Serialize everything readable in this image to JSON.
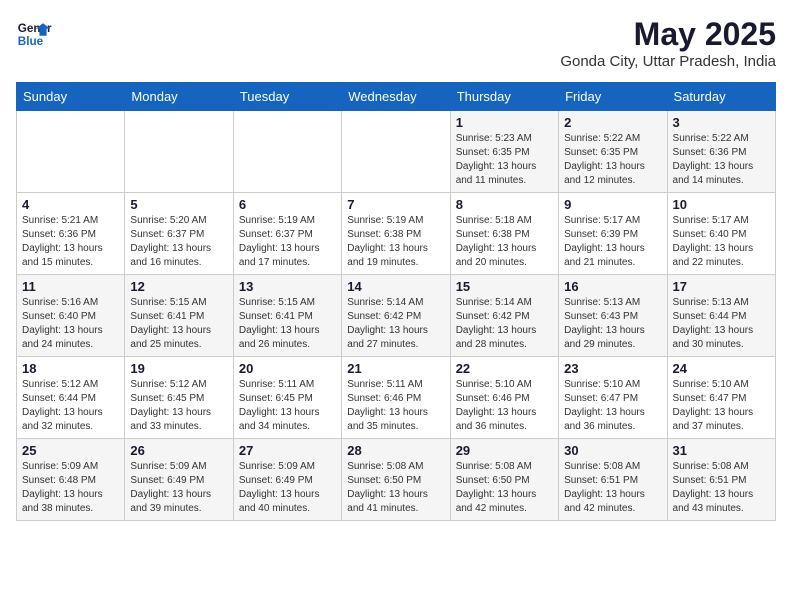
{
  "logo": {
    "line1": "General",
    "line2": "Blue"
  },
  "title": "May 2025",
  "location": "Gonda City, Uttar Pradesh, India",
  "days_of_week": [
    "Sunday",
    "Monday",
    "Tuesday",
    "Wednesday",
    "Thursday",
    "Friday",
    "Saturday"
  ],
  "weeks": [
    [
      {
        "day": "",
        "detail": ""
      },
      {
        "day": "",
        "detail": ""
      },
      {
        "day": "",
        "detail": ""
      },
      {
        "day": "",
        "detail": ""
      },
      {
        "day": "1",
        "detail": "Sunrise: 5:23 AM\nSunset: 6:35 PM\nDaylight: 13 hours\nand 11 minutes."
      },
      {
        "day": "2",
        "detail": "Sunrise: 5:22 AM\nSunset: 6:35 PM\nDaylight: 13 hours\nand 12 minutes."
      },
      {
        "day": "3",
        "detail": "Sunrise: 5:22 AM\nSunset: 6:36 PM\nDaylight: 13 hours\nand 14 minutes."
      }
    ],
    [
      {
        "day": "4",
        "detail": "Sunrise: 5:21 AM\nSunset: 6:36 PM\nDaylight: 13 hours\nand 15 minutes."
      },
      {
        "day": "5",
        "detail": "Sunrise: 5:20 AM\nSunset: 6:37 PM\nDaylight: 13 hours\nand 16 minutes."
      },
      {
        "day": "6",
        "detail": "Sunrise: 5:19 AM\nSunset: 6:37 PM\nDaylight: 13 hours\nand 17 minutes."
      },
      {
        "day": "7",
        "detail": "Sunrise: 5:19 AM\nSunset: 6:38 PM\nDaylight: 13 hours\nand 19 minutes."
      },
      {
        "day": "8",
        "detail": "Sunrise: 5:18 AM\nSunset: 6:38 PM\nDaylight: 13 hours\nand 20 minutes."
      },
      {
        "day": "9",
        "detail": "Sunrise: 5:17 AM\nSunset: 6:39 PM\nDaylight: 13 hours\nand 21 minutes."
      },
      {
        "day": "10",
        "detail": "Sunrise: 5:17 AM\nSunset: 6:40 PM\nDaylight: 13 hours\nand 22 minutes."
      }
    ],
    [
      {
        "day": "11",
        "detail": "Sunrise: 5:16 AM\nSunset: 6:40 PM\nDaylight: 13 hours\nand 24 minutes."
      },
      {
        "day": "12",
        "detail": "Sunrise: 5:15 AM\nSunset: 6:41 PM\nDaylight: 13 hours\nand 25 minutes."
      },
      {
        "day": "13",
        "detail": "Sunrise: 5:15 AM\nSunset: 6:41 PM\nDaylight: 13 hours\nand 26 minutes."
      },
      {
        "day": "14",
        "detail": "Sunrise: 5:14 AM\nSunset: 6:42 PM\nDaylight: 13 hours\nand 27 minutes."
      },
      {
        "day": "15",
        "detail": "Sunrise: 5:14 AM\nSunset: 6:42 PM\nDaylight: 13 hours\nand 28 minutes."
      },
      {
        "day": "16",
        "detail": "Sunrise: 5:13 AM\nSunset: 6:43 PM\nDaylight: 13 hours\nand 29 minutes."
      },
      {
        "day": "17",
        "detail": "Sunrise: 5:13 AM\nSunset: 6:44 PM\nDaylight: 13 hours\nand 30 minutes."
      }
    ],
    [
      {
        "day": "18",
        "detail": "Sunrise: 5:12 AM\nSunset: 6:44 PM\nDaylight: 13 hours\nand 32 minutes."
      },
      {
        "day": "19",
        "detail": "Sunrise: 5:12 AM\nSunset: 6:45 PM\nDaylight: 13 hours\nand 33 minutes."
      },
      {
        "day": "20",
        "detail": "Sunrise: 5:11 AM\nSunset: 6:45 PM\nDaylight: 13 hours\nand 34 minutes."
      },
      {
        "day": "21",
        "detail": "Sunrise: 5:11 AM\nSunset: 6:46 PM\nDaylight: 13 hours\nand 35 minutes."
      },
      {
        "day": "22",
        "detail": "Sunrise: 5:10 AM\nSunset: 6:46 PM\nDaylight: 13 hours\nand 36 minutes."
      },
      {
        "day": "23",
        "detail": "Sunrise: 5:10 AM\nSunset: 6:47 PM\nDaylight: 13 hours\nand 36 minutes."
      },
      {
        "day": "24",
        "detail": "Sunrise: 5:10 AM\nSunset: 6:47 PM\nDaylight: 13 hours\nand 37 minutes."
      }
    ],
    [
      {
        "day": "25",
        "detail": "Sunrise: 5:09 AM\nSunset: 6:48 PM\nDaylight: 13 hours\nand 38 minutes."
      },
      {
        "day": "26",
        "detail": "Sunrise: 5:09 AM\nSunset: 6:49 PM\nDaylight: 13 hours\nand 39 minutes."
      },
      {
        "day": "27",
        "detail": "Sunrise: 5:09 AM\nSunset: 6:49 PM\nDaylight: 13 hours\nand 40 minutes."
      },
      {
        "day": "28",
        "detail": "Sunrise: 5:08 AM\nSunset: 6:50 PM\nDaylight: 13 hours\nand 41 minutes."
      },
      {
        "day": "29",
        "detail": "Sunrise: 5:08 AM\nSunset: 6:50 PM\nDaylight: 13 hours\nand 42 minutes."
      },
      {
        "day": "30",
        "detail": "Sunrise: 5:08 AM\nSunset: 6:51 PM\nDaylight: 13 hours\nand 42 minutes."
      },
      {
        "day": "31",
        "detail": "Sunrise: 5:08 AM\nSunset: 6:51 PM\nDaylight: 13 hours\nand 43 minutes."
      }
    ]
  ]
}
